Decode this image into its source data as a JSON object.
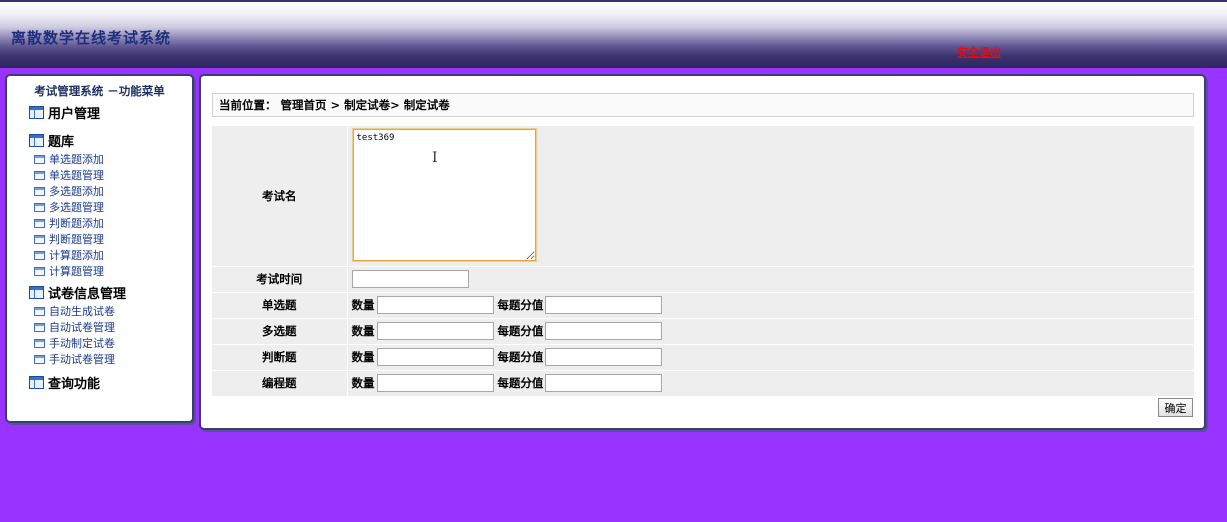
{
  "header": {
    "title": "离散数学在线考试系统",
    "logout": "安全退出"
  },
  "sidebar": {
    "title": "考试管理系统 －功能菜单",
    "groups": [
      {
        "label": "用户管理",
        "items": []
      },
      {
        "label": "题库",
        "items": [
          "单选题添加",
          "单选题管理",
          "多选题添加",
          "多选题管理",
          "判断题添加",
          "判断题管理",
          "计算题添加",
          "计算题管理"
        ]
      },
      {
        "label": "试卷信息管理",
        "items": [
          "自动生成试卷",
          "自动试卷管理",
          "手动制定试卷",
          "手动试卷管理"
        ]
      },
      {
        "label": "查询功能",
        "items": []
      }
    ]
  },
  "breadcrumb": {
    "prefix": "当前位置：",
    "parts": [
      "管理首页",
      "> 制定试卷>",
      "制定试卷"
    ]
  },
  "form": {
    "exam_name_label": "考试名",
    "exam_name_value": "test369",
    "exam_time_label": "考试时间",
    "exam_time_value": "",
    "count_label": "数量",
    "score_label": "每题分值",
    "rows": [
      {
        "label": "单选题",
        "count": "",
        "score": ""
      },
      {
        "label": "多选题",
        "count": "",
        "score": ""
      },
      {
        "label": "判断题",
        "count": "",
        "score": ""
      },
      {
        "label": "编程题",
        "count": "",
        "score": ""
      }
    ],
    "submit_label": "确定"
  }
}
